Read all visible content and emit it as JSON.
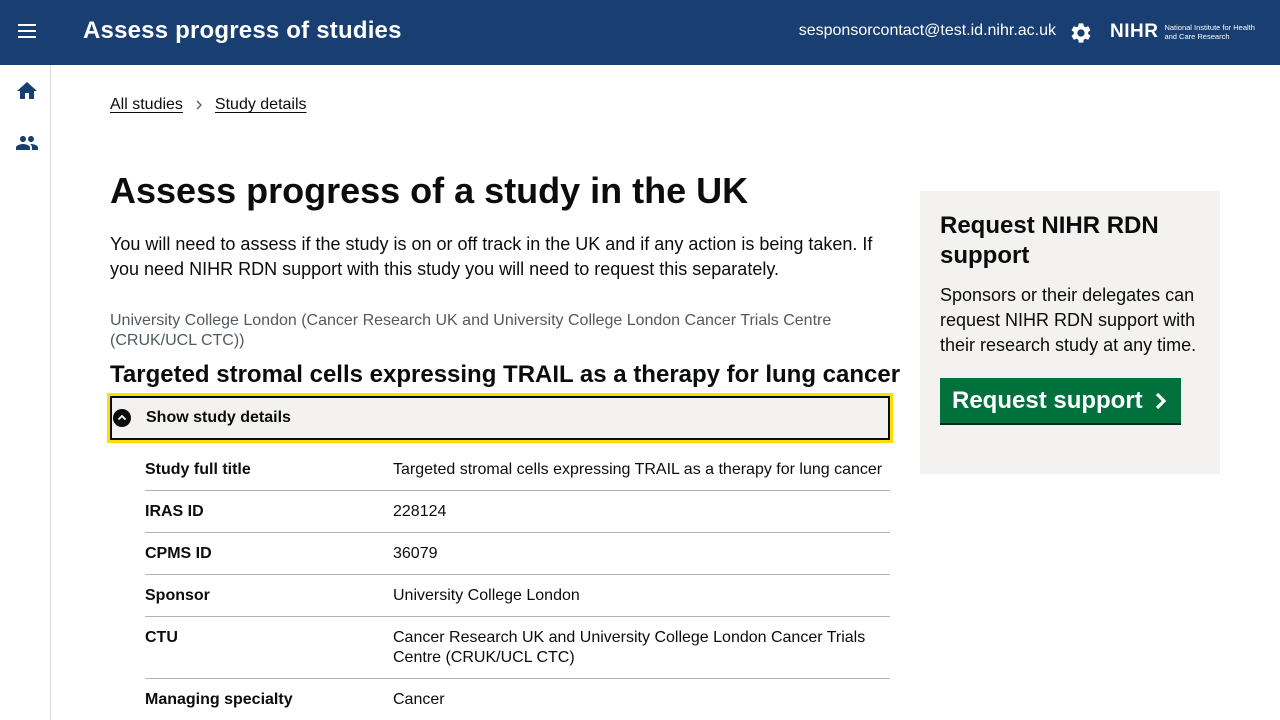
{
  "header": {
    "title": "Assess progress of studies",
    "email": "sesponsorcontact@test.id.nihr.ac.uk",
    "logo_main": "NIHR",
    "logo_sub": "National Institute for Health and Care Research",
    "icons": [
      "menu-icon",
      "gear-icon"
    ]
  },
  "sidebar": {
    "icons": [
      "home-icon",
      "users-icon"
    ]
  },
  "breadcrumb": {
    "items": [
      "All studies",
      "Study details"
    ]
  },
  "main": {
    "heading": "Assess progress of a study in the UK",
    "lead": "You will need to assess if the study is on or off track in the UK and if any action is being taken. If you need NIHR RDN support with this study you will need to request this separately.",
    "organisation": "University College London (Cancer Research UK and University College London Cancer Trials Centre (CRUK/UCL CTC))",
    "study_title": "Targeted stromal cells expressing TRAIL as a therapy for lung cancer",
    "toggle_label": "Show study details",
    "details": [
      {
        "key": "Study full title",
        "value": "Targeted stromal cells expressing TRAIL as a therapy for lung cancer"
      },
      {
        "key": "IRAS ID",
        "value": "228124"
      },
      {
        "key": "CPMS ID",
        "value": "36079"
      },
      {
        "key": "Sponsor",
        "value": "University College London"
      },
      {
        "key": "CTU",
        "value": "Cancer Research UK and University College London Cancer Trials Centre (CRUK/UCL CTC)"
      },
      {
        "key": "Managing specialty",
        "value": "Cancer"
      }
    ]
  },
  "aside": {
    "title": "Request NIHR RDN support",
    "text": "Sponsors or their delegates can request NIHR RDN support with their research study at any time.",
    "button_label": "Request support"
  },
  "colors": {
    "header_bg": "#193e72",
    "button_green": "#00703c",
    "focus_yellow": "#ffdd00",
    "panel_grey": "#f3f2f1"
  }
}
